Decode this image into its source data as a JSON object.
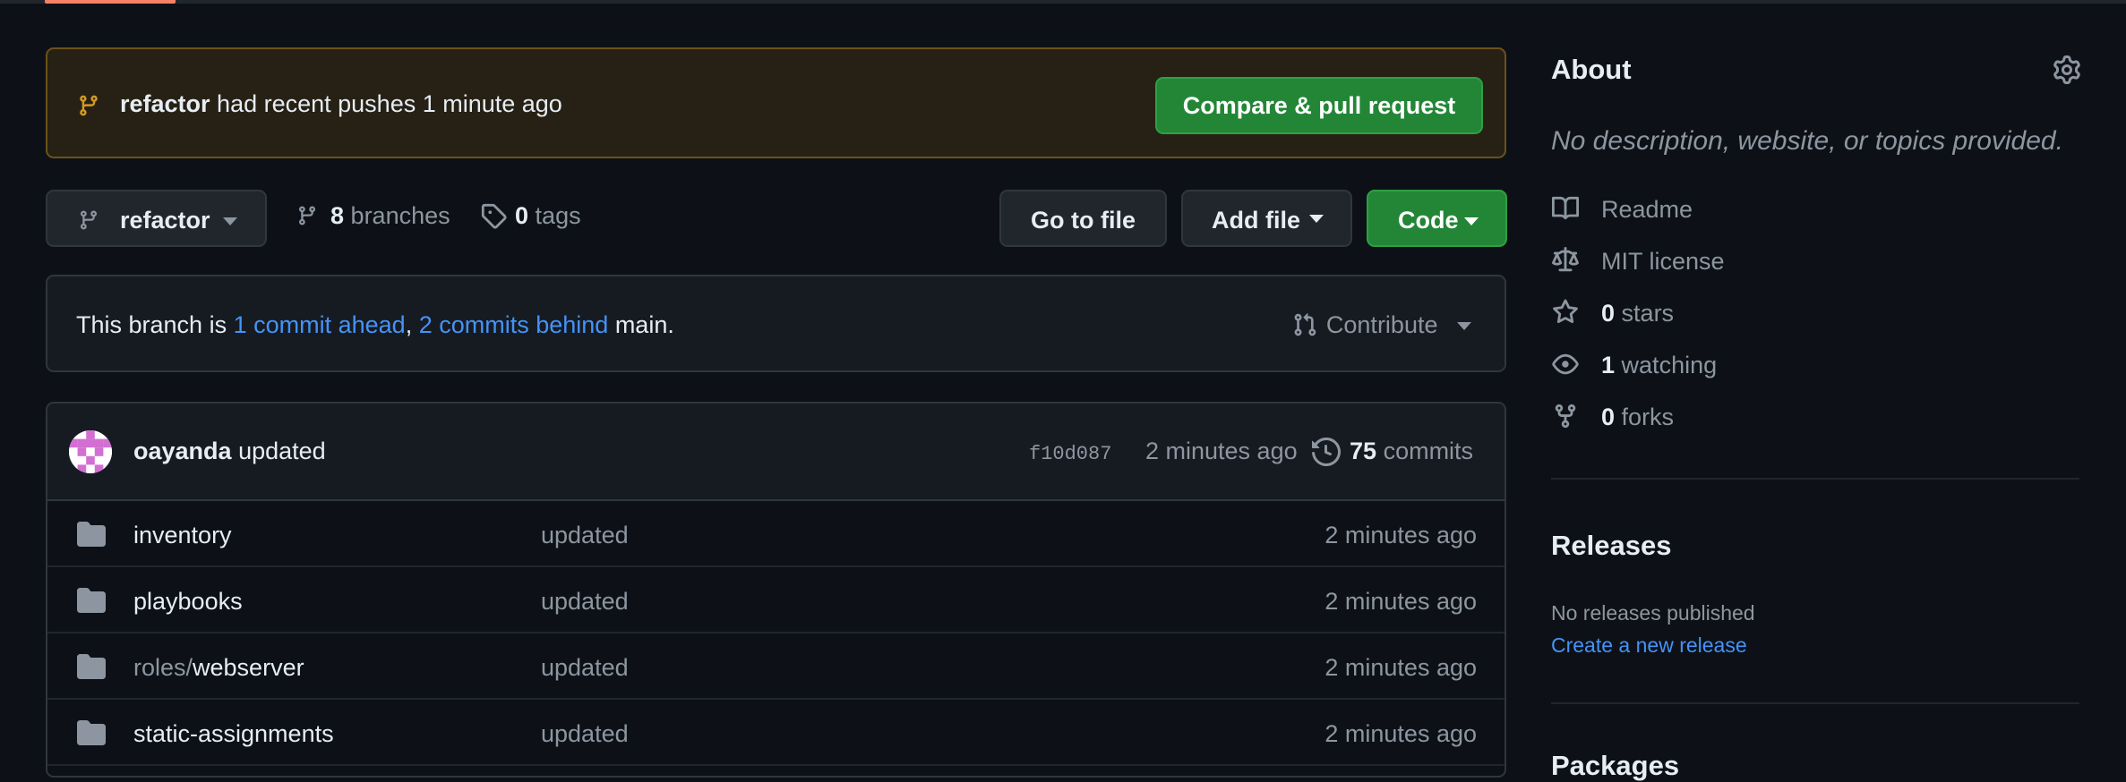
{
  "banner": {
    "branch": "refactor",
    "message": " had recent pushes 1 minute ago",
    "button": "Compare & pull request"
  },
  "toolbar": {
    "branch": "refactor",
    "branches_count": "8",
    "branches_label": "branches",
    "tags_count": "0",
    "tags_label": "tags",
    "go_to_file": "Go to file",
    "add_file": "Add file",
    "code": "Code"
  },
  "branch_status": {
    "prefix": "This branch is ",
    "ahead": "1 commit ahead",
    "sep": ", ",
    "behind": "2 commits behind",
    "suffix": " main.",
    "contribute": "Contribute"
  },
  "latest_commit": {
    "author": "oayanda",
    "message": "updated",
    "sha": "f10d087",
    "time": "2 minutes ago",
    "commits_count": "75",
    "commits_label": "commits"
  },
  "files": [
    {
      "prefix": "",
      "name": "inventory",
      "message": "updated",
      "age": "2 minutes ago"
    },
    {
      "prefix": "",
      "name": "playbooks",
      "message": "updated",
      "age": "2 minutes ago"
    },
    {
      "prefix": "roles/",
      "name": "webserver",
      "message": "updated",
      "age": "2 minutes ago"
    },
    {
      "prefix": "",
      "name": "static-assignments",
      "message": "updated",
      "age": "2 minutes ago"
    }
  ],
  "about": {
    "title": "About",
    "description": "No description, website, or topics provided.",
    "readme": "Readme",
    "license": "MIT license",
    "stars_count": "0",
    "stars_label": "stars",
    "watching_count": "1",
    "watching_label": "watching",
    "forks_count": "0",
    "forks_label": "forks"
  },
  "releases": {
    "title": "Releases",
    "none": "No releases published",
    "create": "Create a new release"
  },
  "packages": {
    "title": "Packages"
  },
  "colors": {
    "background": "#0d1117",
    "accent_green": "#238636",
    "link_blue": "#4493f8",
    "banner_bg": "#272115",
    "banner_icon": "#d29922",
    "muted": "#8d96a0"
  }
}
